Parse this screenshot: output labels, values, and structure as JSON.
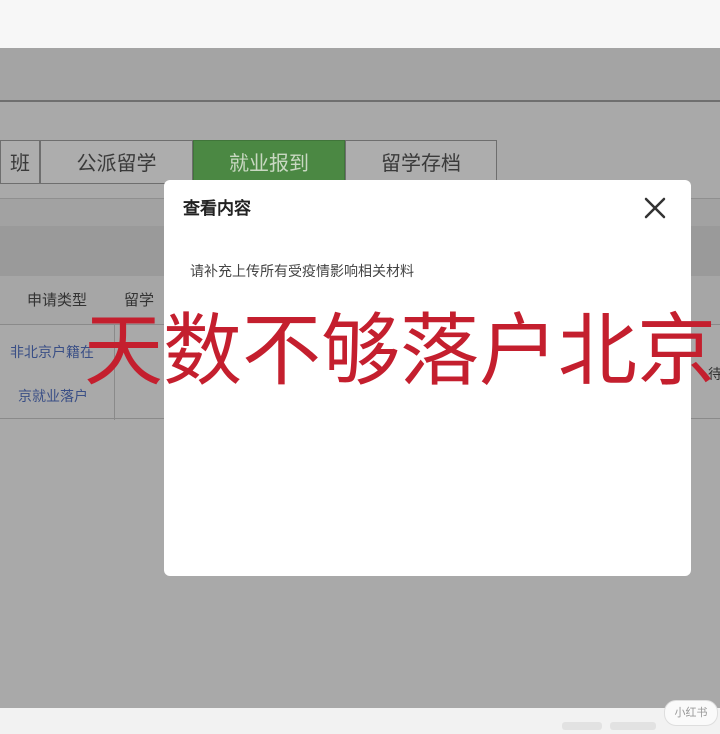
{
  "tabs": [
    "班",
    "公派留学",
    "就业报到",
    "留学存档"
  ],
  "table": {
    "headers": [
      "申请类型",
      "留学"
    ],
    "row": [
      "非北京户籍在",
      "京就业落户"
    ],
    "right_cell": "待"
  },
  "dialog": {
    "title": "查看内容",
    "body": "请补充上传所有受疫情影响相关材料"
  },
  "overlay_text": "天数不够落户北京",
  "watermark": "小红书",
  "colors": {
    "active_tab": "#4b8843",
    "overlay_text": "#c41f2e",
    "link_text": "#3a4f86"
  }
}
